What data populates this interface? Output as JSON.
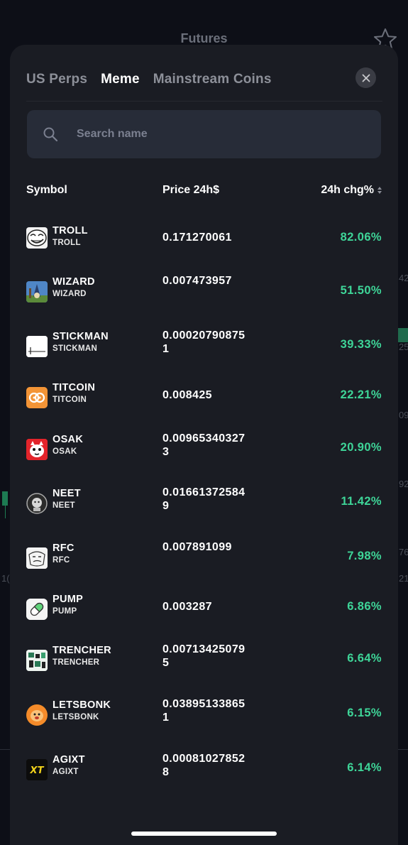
{
  "background": {
    "title": "Futures",
    "side_numbers": [
      "42",
      "25",
      "09",
      "92",
      "76",
      "21",
      "1("
    ]
  },
  "tabs": [
    {
      "label": "US Perps",
      "active": false
    },
    {
      "label": "Meme",
      "active": true
    },
    {
      "label": "Mainstream Coins",
      "active": false
    }
  ],
  "search": {
    "placeholder": "Search name",
    "value": ""
  },
  "table_headers": {
    "symbol": "Symbol",
    "price": "Price 24h$",
    "change": "24h chg%"
  },
  "coins": [
    {
      "name": "TROLL",
      "sub": "TROLL",
      "price": "0.171270061",
      "change": "82.06%",
      "icon": "troll-face-icon"
    },
    {
      "name": "WIZARD",
      "sub": "WIZARD",
      "price": "0.007473957",
      "change": "51.50%",
      "icon": "wizard-icon"
    },
    {
      "name": "STICKMAN",
      "sub": "STICKMAN",
      "price": "0.000207908751",
      "change": "39.33%",
      "icon": "stickman-icon"
    },
    {
      "name": "TITCOIN",
      "sub": "TITCOIN",
      "price": "0.008425",
      "change": "22.21%",
      "icon": "titcoin-icon"
    },
    {
      "name": "OSAK",
      "sub": "OSAK",
      "price": "0.009653403273",
      "change": "20.90%",
      "icon": "osak-icon"
    },
    {
      "name": "NEET",
      "sub": "NEET",
      "price": "0.016613725849",
      "change": "11.42%",
      "icon": "neet-icon"
    },
    {
      "name": "RFC",
      "sub": "RFC",
      "price": "0.007891099",
      "change": "7.98%",
      "icon": "rfc-icon"
    },
    {
      "name": "PUMP",
      "sub": "PUMP",
      "price": "0.003287",
      "change": "6.86%",
      "icon": "pill-icon"
    },
    {
      "name": "TRENCHER",
      "sub": "TRENCHER",
      "price": "0.007134250795",
      "change": "6.64%",
      "icon": "trencher-icon"
    },
    {
      "name": "LETSBONK",
      "sub": "LETSBONK",
      "price": "0.038951338651",
      "change": "6.15%",
      "icon": "letsbonk-icon"
    },
    {
      "name": "AGIXT",
      "sub": "AGIXT",
      "price": "0.000810278528",
      "change": "6.14%",
      "icon": "agixt-icon"
    }
  ],
  "colors": {
    "positive": "#3ed598",
    "sheet": "#1a1c23",
    "search_bg": "#272c38"
  }
}
